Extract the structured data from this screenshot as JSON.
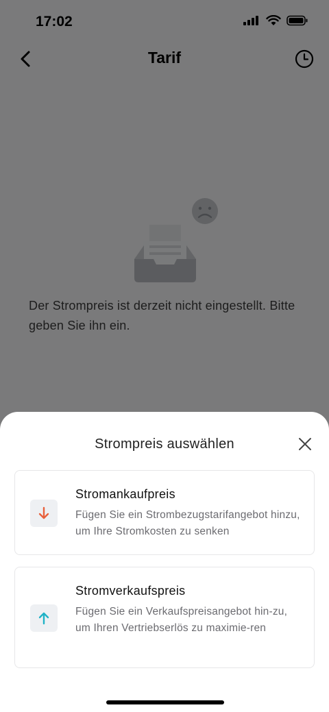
{
  "status_bar": {
    "time": "17:02"
  },
  "nav": {
    "title": "Tarif"
  },
  "empty_state": {
    "message": "Der Strompreis ist derzeit nicht eingestellt. Bitte geben Sie ihn ein."
  },
  "sheet": {
    "title": "Strompreis auswählen",
    "options": [
      {
        "title": "Stromankaufpreis",
        "description": "Fügen Sie ein Strombezugstarifangebot hinzu, um Ihre Stromkosten zu senken",
        "icon": "arrow-down-icon",
        "color": "#e8603c"
      },
      {
        "title": "Stromverkaufspreis",
        "description": "Fügen Sie ein Verkaufspreisangebot hin-zu, um Ihren Vertriebserlös zu maximie-ren",
        "icon": "arrow-up-icon",
        "color": "#1fb2c6"
      }
    ]
  }
}
